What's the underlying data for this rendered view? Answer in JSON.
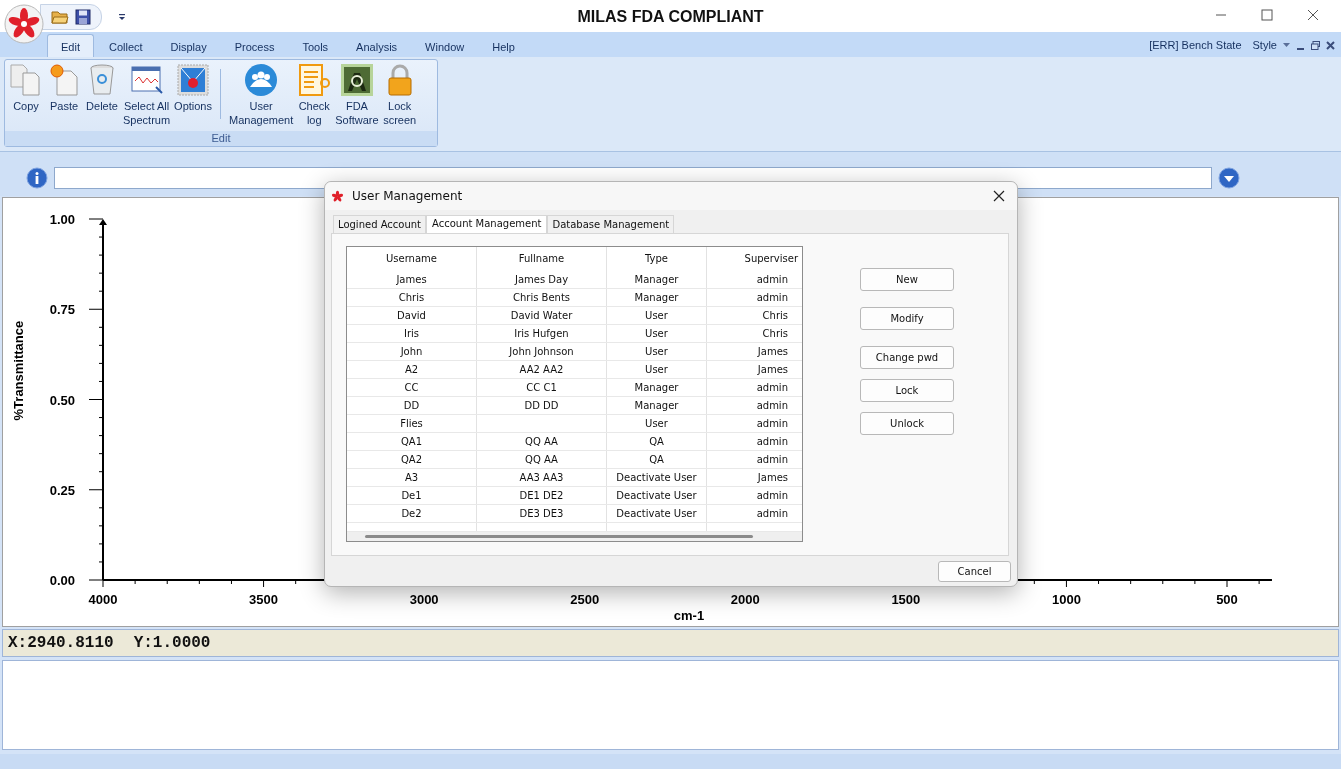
{
  "window": {
    "title": "MILAS FDA COMPLIANT"
  },
  "menu_tabs": [
    {
      "label": "Edit",
      "selected": true
    },
    {
      "label": "Collect",
      "selected": false
    },
    {
      "label": "Display",
      "selected": false
    },
    {
      "label": "Process",
      "selected": false
    },
    {
      "label": "Tools",
      "selected": false
    },
    {
      "label": "Analysis",
      "selected": false
    },
    {
      "label": "Window",
      "selected": false
    },
    {
      "label": "Help",
      "selected": false
    }
  ],
  "status_right": {
    "bench_state": "[ERR] Bench State",
    "style": "Style"
  },
  "ribbon": {
    "group": "Edit",
    "buttons": [
      {
        "label": "Copy",
        "kind": "copy"
      },
      {
        "label": "Paste",
        "kind": "paste"
      },
      {
        "label": "Delete",
        "kind": "delete"
      },
      {
        "label": "Select All\nSpectrum",
        "kind": "select"
      },
      {
        "label": "Options",
        "kind": "options"
      },
      {
        "label": "User\nManagement",
        "kind": "users"
      },
      {
        "label": "Check\nlog",
        "kind": "log"
      },
      {
        "label": "FDA\nSoftware",
        "kind": "fda"
      },
      {
        "label": "Lock\nscreen",
        "kind": "lock"
      }
    ]
  },
  "chart": {
    "chart_data": {
      "type": "line",
      "xlabel": "cm-1",
      "ylabel": "%Transmittance",
      "xlim": [
        4000,
        360
      ],
      "ylim": [
        0,
        1
      ],
      "xticks": [
        4000,
        3500,
        3000,
        2500,
        2000,
        1500,
        1000,
        500
      ],
      "yticks": [
        {
          "value": 0,
          "label": "0.00"
        },
        {
          "value": 0.25,
          "label": "0.25"
        },
        {
          "value": 0.5,
          "label": "0.50"
        },
        {
          "value": 0.75,
          "label": "0.75"
        },
        {
          "value": 1,
          "label": "1.00"
        }
      ]
    }
  },
  "coordinates": {
    "x": "X:2940.8110",
    "y": "Y:1.0000"
  },
  "dialog": {
    "title": "User Management",
    "tabs": [
      {
        "label": "Logined Account",
        "selected": false
      },
      {
        "label": "Account Management",
        "selected": true
      },
      {
        "label": "Database Management",
        "selected": false
      }
    ],
    "columns": [
      "Username",
      "Fullname",
      "Type",
      "Superviser"
    ],
    "rows": [
      [
        "James",
        "James Day",
        "Manager",
        "admin"
      ],
      [
        "Chris",
        "Chris Bents",
        "Manager",
        "admin"
      ],
      [
        "David",
        "David Water",
        "User",
        "Chris"
      ],
      [
        "Iris",
        "Iris Hufgen",
        "User",
        "Chris"
      ],
      [
        "John",
        "John Johnson",
        "User",
        "James"
      ],
      [
        "A2",
        "AA2 AA2",
        "User",
        "James"
      ],
      [
        "CC",
        "CC C1",
        "Manager",
        "admin"
      ],
      [
        "DD",
        "DD DD",
        "Manager",
        "admin"
      ],
      [
        "Flies",
        "",
        "User",
        "admin"
      ],
      [
        "QA1",
        "QQ AA",
        "QA",
        "admin"
      ],
      [
        "QA2",
        "QQ AA",
        "QA",
        "admin"
      ],
      [
        "A3",
        "AA3 AA3",
        "Deactivate User",
        "James"
      ],
      [
        "De1",
        "DE1 DE2",
        "Deactivate User",
        "admin"
      ],
      [
        "De2",
        "DE3 DE3",
        "Deactivate User",
        "admin"
      ]
    ],
    "buttons": [
      "New",
      "Modify",
      "Change pwd",
      "Lock",
      "Unlock"
    ],
    "cancel": "Cancel"
  }
}
